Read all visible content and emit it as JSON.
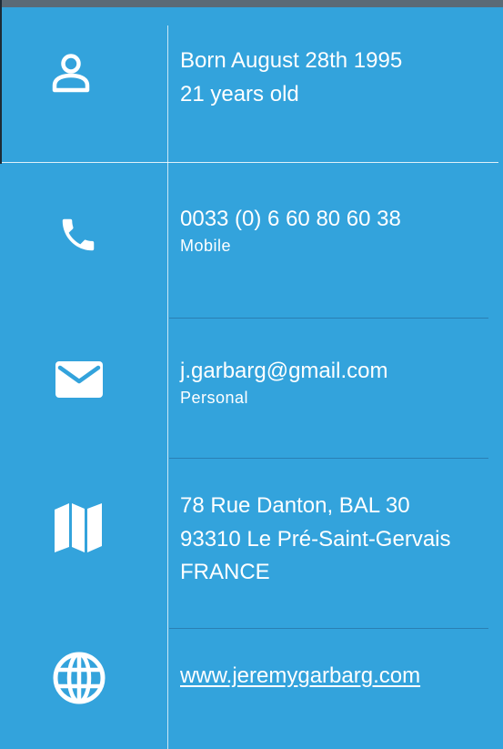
{
  "birth": {
    "line1": "Born August 28th 1995",
    "line2": "21 years old",
    "icon": "person-icon"
  },
  "phone": {
    "number": "0033 (0) 6 60 80 60 38",
    "type": "Mobile",
    "icon": "phone-icon"
  },
  "email": {
    "address": "j.garbarg@gmail.com",
    "type": "Personal",
    "icon": "envelope-icon"
  },
  "address": {
    "line1": "78 Rue Danton, BAL 30",
    "line2": "93310  Le Pré-Saint-Gervais",
    "line3": "FRANCE",
    "icon": "map-icon"
  },
  "website": {
    "url": "www.jeremygarbarg.com",
    "icon": "globe-icon"
  },
  "colors": {
    "background": "#33a3dc",
    "text": "#ffffff",
    "divider_dark": "#2a7fb3"
  }
}
